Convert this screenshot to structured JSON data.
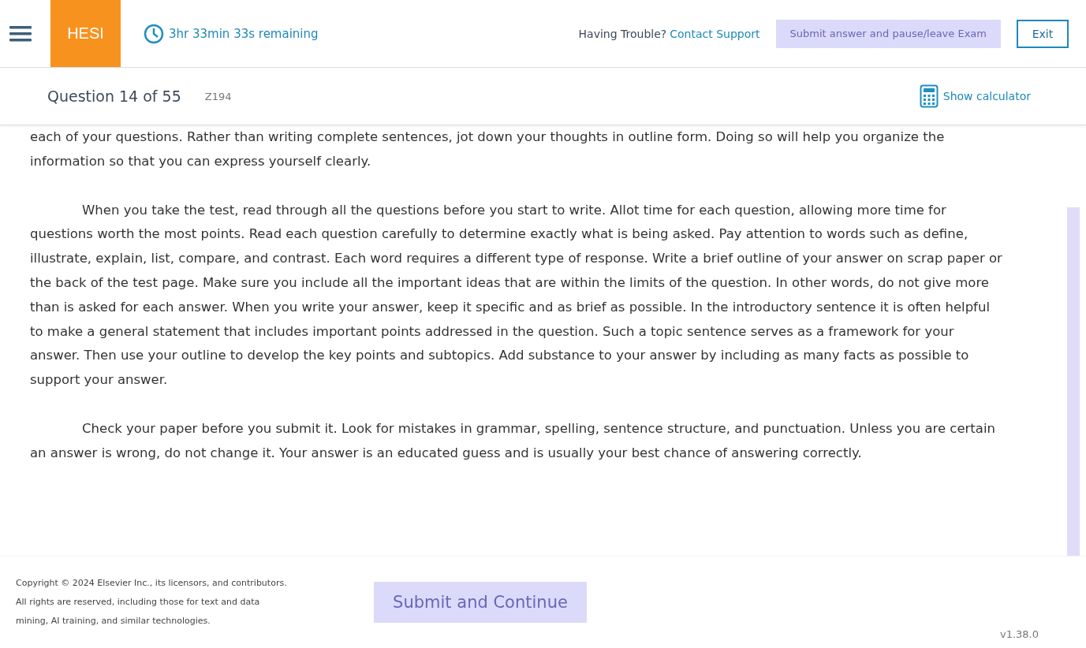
{
  "header": {
    "logo": "HESI",
    "timer": "3hr 33min 33s remaining",
    "trouble": "Having Trouble?",
    "support_link": "Contact Support",
    "pause_button": {
      "label": "Submit answer and pause/leave Exam",
      "disabled": true
    },
    "exit_button": "Exit"
  },
  "question_bar": {
    "title": "Question 14 of 55",
    "code": "Z194",
    "calculator": "Show calculator"
  },
  "paragraphs": [
    {
      "indent": false,
      "text": "each of your questions.  Rather than writing complete sentences, jot down your thoughts in outline form.  Doing so will help you organize the information so that you can express yourself clearly."
    },
    {
      "indent": true,
      "text": "When you take the test, read through all the questions before you start to write. Allot time for each question, allowing more time for questions worth the most points. Read each question carefully to determine exactly what is being asked.  Pay attention to words such as define, illustrate, explain, list, compare, and contrast.  Each word requires a different type of response.  Write a brief outline of your answer on scrap paper or the back of the test page.  Make sure you include all the important ideas that are within the limits of the question.  In other words, do not give more than is asked for each answer. When you write your answer, keep it specific and as brief as possible.  In the introductory sentence it is often helpful to make a general statement that includes important points addressed in the question.  Such a topic sentence serves as a framework for your answer. Then use your outline to develop the key points and subtopics.  Add substance to your answer by including as many facts as possible to support your answer."
    },
    {
      "indent": true,
      "text": "Check your paper before you submit it.  Look for mistakes in grammar, spelling, sentence structure, and punctuation.  Unless you are certain an answer is wrong, do not change it. Your answer is an educated guess and is usually your best chance of answering correctly."
    }
  ],
  "footer": {
    "copyright": "Copyright © 2024 Elsevier Inc., its licensors, and contributors. All rights are reserved, including those for text and data mining, AI training, and similar technologies.",
    "submit_button": {
      "label": "Submit and Continue",
      "disabled": true
    },
    "version": "v1.38.0"
  }
}
